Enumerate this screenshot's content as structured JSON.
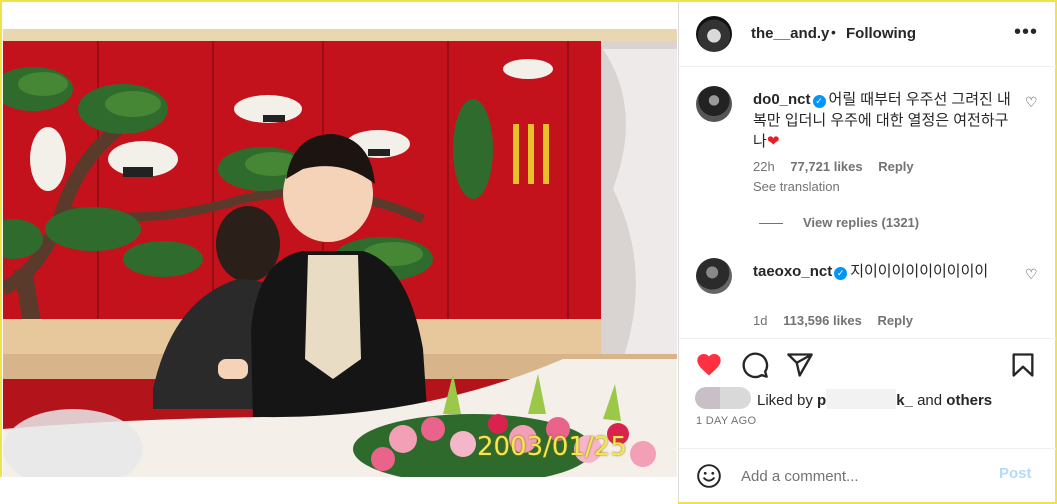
{
  "photo": {
    "date_stamp": "2003/01/25"
  },
  "header": {
    "username": "the__and.y",
    "separator": "•",
    "follow_status": "Following",
    "more_icon": "more-horizontal-icon"
  },
  "comments": [
    {
      "username": "do0_nct",
      "verified": true,
      "text": "어릴 때부터 우주선 그려진 내복만 입더니 우주에 대한 열정은 여전하구나",
      "emoji": "❤",
      "time": "22h",
      "likes": "77,721 likes",
      "reply": "Reply",
      "see_translation": "See translation",
      "view_replies": "View replies (1321)"
    },
    {
      "username": "taeoxo_nct",
      "verified": true,
      "text": "지이이이이이이이이이",
      "time": "1d",
      "likes": "113,596 likes",
      "reply": "Reply"
    }
  ],
  "actions": {
    "like_icon": "heart-filled-icon",
    "comment_icon": "comment-icon",
    "share_icon": "share-icon",
    "save_icon": "bookmark-icon",
    "like_color": "#ff3040"
  },
  "liked_by": {
    "prefix": "Liked by",
    "name_start": "p",
    "name_end": "k_",
    "and": "and",
    "others": "others"
  },
  "post_date": "1 DAY AGO",
  "add_comment": {
    "placeholder": "Add a comment...",
    "post_label": "Post"
  }
}
